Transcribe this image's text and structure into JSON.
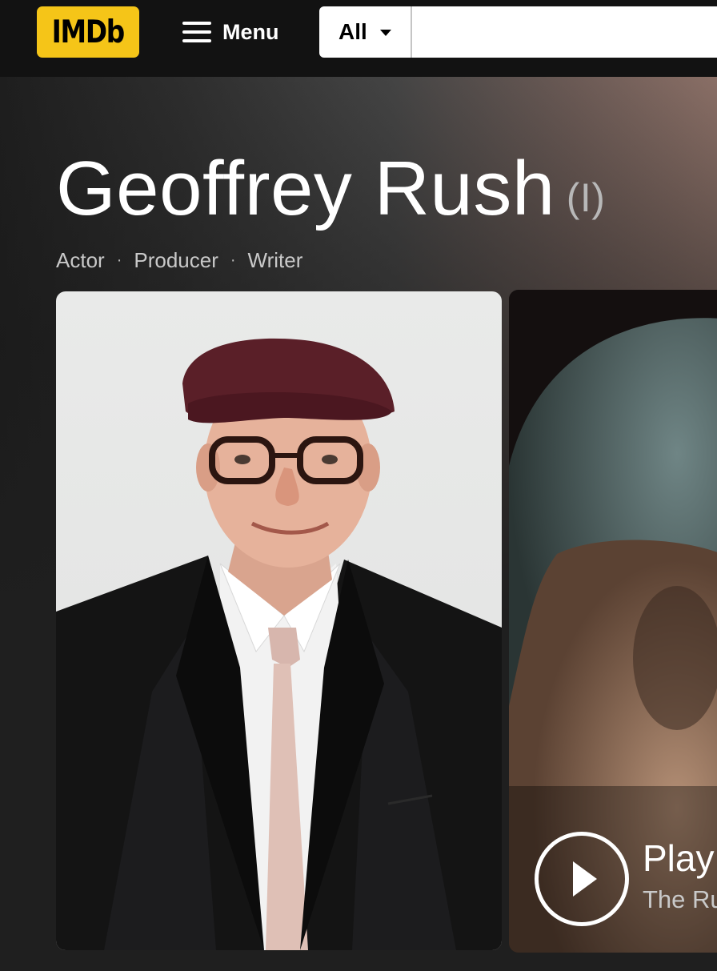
{
  "navbar": {
    "logo_text": "IMDb",
    "menu_label": "Menu",
    "search": {
      "category": "All",
      "placeholder": "",
      "value": ""
    }
  },
  "person": {
    "name": "Geoffrey Rush",
    "disambiguation": "(I)",
    "professions": [
      "Actor",
      "Producer",
      "Writer"
    ],
    "separator": "·"
  },
  "video": {
    "play_label": "Play",
    "title_partial": "The Ru"
  },
  "colors": {
    "brand_yellow": "#f5c518",
    "nav_background": "#121212",
    "page_background": "#1f1f1f"
  },
  "icons": {
    "menu": "hamburger-icon",
    "dropdown": "caret-down-icon",
    "play": "play-icon"
  }
}
